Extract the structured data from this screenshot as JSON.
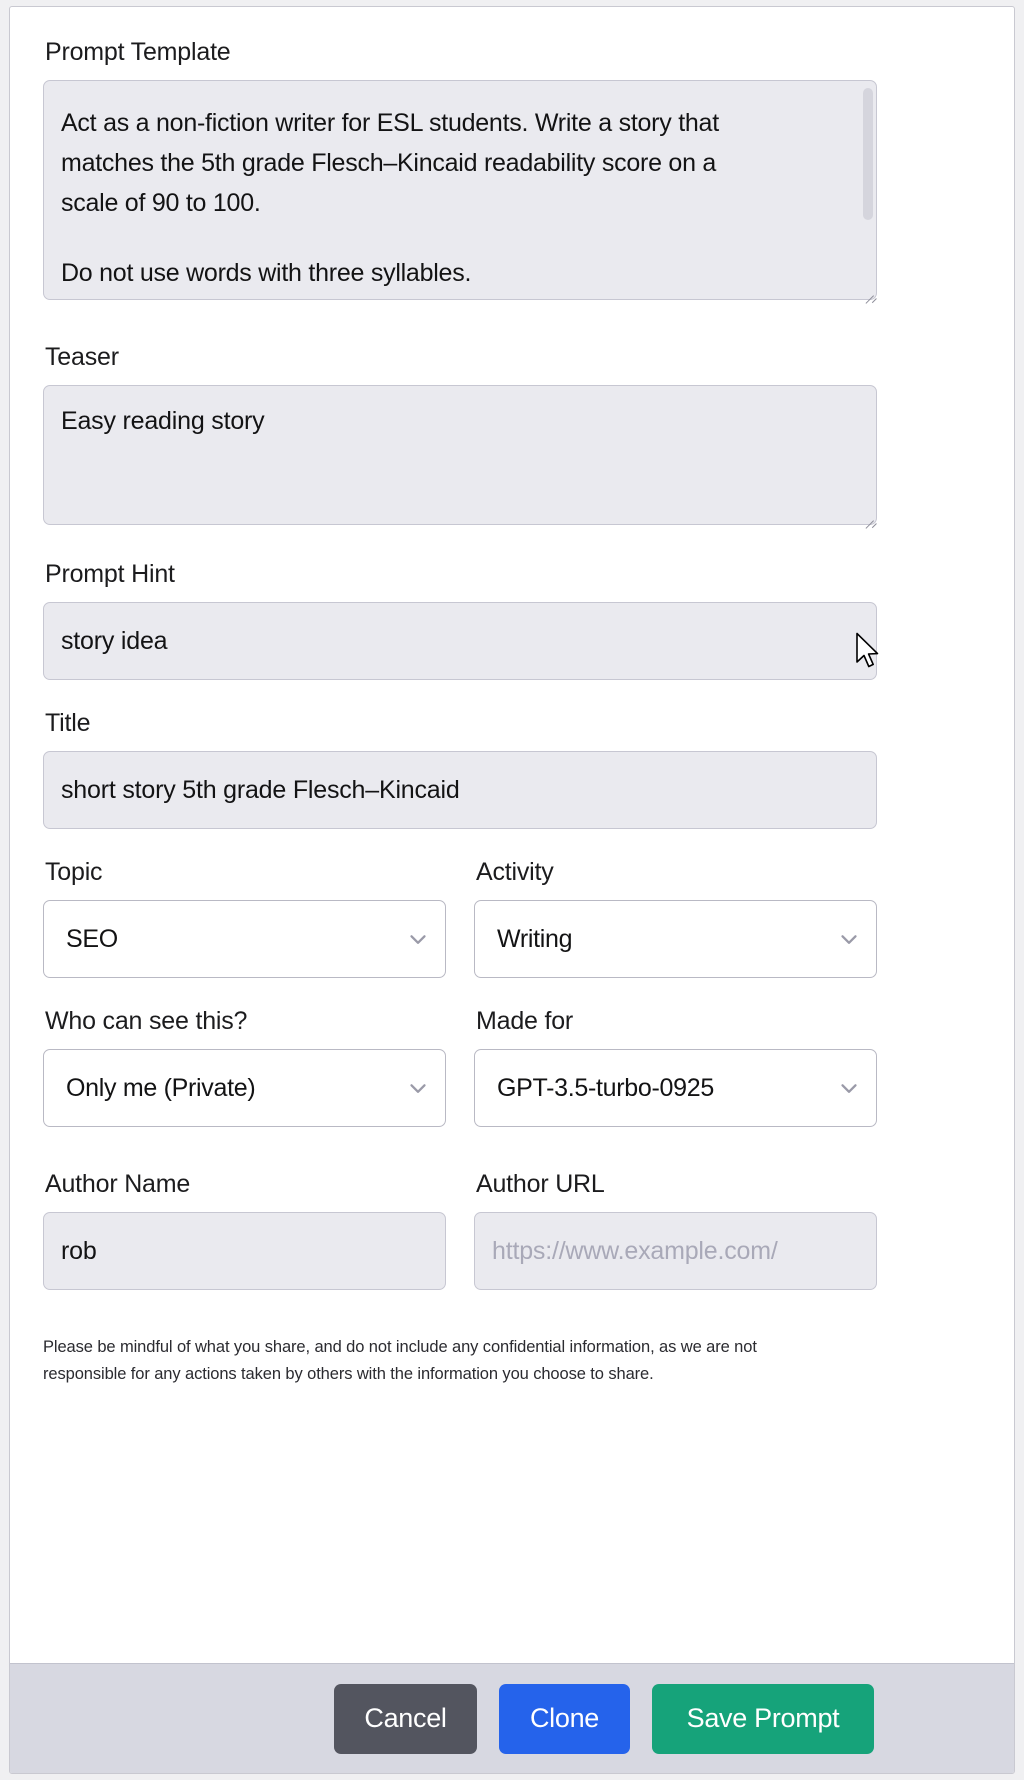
{
  "form": {
    "prompt_template": {
      "label": "Prompt Template",
      "lines": [
        "Act as a non-fiction writer for ESL students. Write a story that",
        "matches the 5th grade Flesch–Kincaid readability score on a",
        "scale of 90 to 100."
      ],
      "clipped_line": "Do not use words with three syllables."
    },
    "teaser": {
      "label": "Teaser",
      "value": "Easy reading story"
    },
    "prompt_hint": {
      "label": "Prompt Hint",
      "value": "story idea"
    },
    "title": {
      "label": "Title",
      "value": "short story 5th grade Flesch–Kincaid"
    },
    "topic": {
      "label": "Topic",
      "value": "SEO"
    },
    "activity": {
      "label": "Activity",
      "value": "Writing"
    },
    "visibility": {
      "label": "Who can see this?",
      "value": "Only me (Private)"
    },
    "made_for": {
      "label": "Made for",
      "value": "GPT-3.5-turbo-0925"
    },
    "author_name": {
      "label": "Author Name",
      "value": "rob"
    },
    "author_url": {
      "label": "Author URL",
      "value": "",
      "placeholder": "https://www.example.com/"
    },
    "disclaimer": "Please be mindful of what you share, and do not include any confidential information, as we are not responsible for any actions taken by others with the information you choose to share."
  },
  "footer": {
    "cancel_label": "Cancel",
    "clone_label": "Clone",
    "save_label": "Save Prompt"
  },
  "colors": {
    "cancel": "#53555F",
    "clone": "#2563EB",
    "save": "#16A37A",
    "field_fill": "#EAEAEF",
    "footer_bar": "#D7D8E1"
  }
}
